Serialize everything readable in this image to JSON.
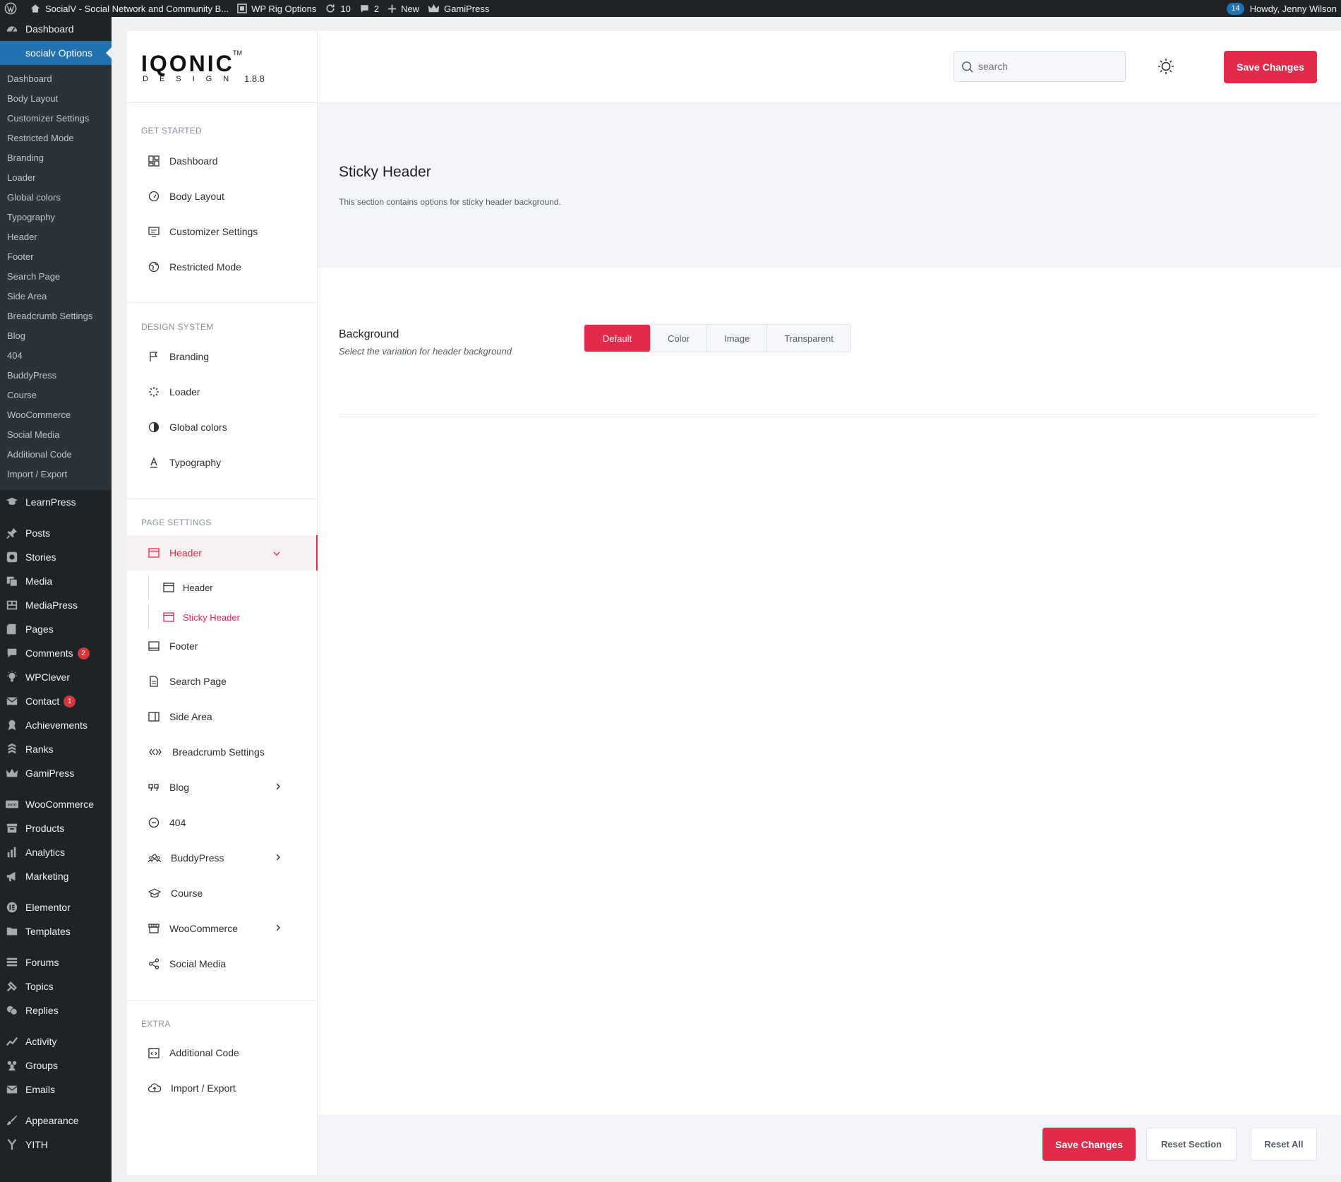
{
  "adminbar": {
    "site_name": "SocialV - Social Network and Community B...",
    "rig_options": "WP Rig Options",
    "updates_count": "10",
    "comments_count": "2",
    "new_label": "New",
    "gamipress_label": "GamiPress",
    "notif_count": "14",
    "howdy": "Howdy, Jenny Wilson"
  },
  "wpmenu": {
    "dashboard": "Dashboard",
    "options": "socialv Options",
    "submenu": [
      "Dashboard",
      "Body Layout",
      "Customizer Settings",
      "Restricted Mode",
      "Branding",
      "Loader",
      "Global colors",
      "Typography",
      "Header",
      "Footer",
      "Search Page",
      "Side Area",
      "Breadcrumb Settings",
      "Blog",
      "404",
      "BuddyPress",
      "Course",
      "WooCommerce",
      "Social Media",
      "Additional Code",
      "Import / Export"
    ],
    "learnpress": "LearnPress",
    "posts": "Posts",
    "stories": "Stories",
    "media": "Media",
    "mediapress": "MediaPress",
    "pages": "Pages",
    "comments": "Comments",
    "comments_badge": "2",
    "wpclever": "WPClever",
    "contact": "Contact",
    "contact_badge": "1",
    "achievements": "Achievements",
    "ranks": "Ranks",
    "gamipress": "GamiPress",
    "woocommerce": "WooCommerce",
    "products": "Products",
    "analytics": "Analytics",
    "marketing": "Marketing",
    "elementor": "Elementor",
    "templates": "Templates",
    "forums": "Forums",
    "topics": "Topics",
    "replies": "Replies",
    "activity": "Activity",
    "groups": "Groups",
    "emails": "Emails",
    "appearance": "Appearance",
    "yith": "YITH"
  },
  "logo": {
    "main": "IQONIC",
    "tm": "TM",
    "design": "DESIGN",
    "version": "1.8.8"
  },
  "search": {
    "value": "",
    "placeholder": "search"
  },
  "topbar": {
    "save_label": "Save Changes"
  },
  "sidenav": {
    "get_started": "GET STARTED",
    "dashboard": "Dashboard",
    "body_layout": "Body Layout",
    "customizer_settings": "Customizer Settings",
    "restricted_mode": "Restricted Mode",
    "design_system": "DESIGN SYSTEM",
    "branding": "Branding",
    "loader": "Loader",
    "global_colors": "Global colors",
    "typography": "Typography",
    "page_settings": "PAGE SETTINGS",
    "header": "Header",
    "header_sub": "Header",
    "sticky_header": "Sticky Header",
    "footer": "Footer",
    "search_page": "Search Page",
    "side_area": "Side Area",
    "breadcrumb": "Breadcrumb Settings",
    "blog": "Blog",
    "p404": "404",
    "buddypress": "BuddyPress",
    "course": "Course",
    "woocommerce": "WooCommerce",
    "social_media": "Social Media",
    "extra": "EXTRA",
    "additional_code": "Additional Code",
    "import_export": "Import / Export"
  },
  "section": {
    "title": "Sticky Header",
    "description": "This section contains options for sticky header background."
  },
  "option": {
    "label": "Background",
    "desc": "Select the variation for header background",
    "choices": [
      "Default",
      "Color",
      "Image",
      "Transparent"
    ],
    "selected": "Default"
  },
  "footer": {
    "save_label": "Save Changes",
    "reset_section": "Reset Section",
    "reset_all": "Reset All"
  },
  "colors": {
    "accent": "#e22a4a",
    "wp_dark": "#1d2327",
    "wp_blue": "#2271b1"
  }
}
